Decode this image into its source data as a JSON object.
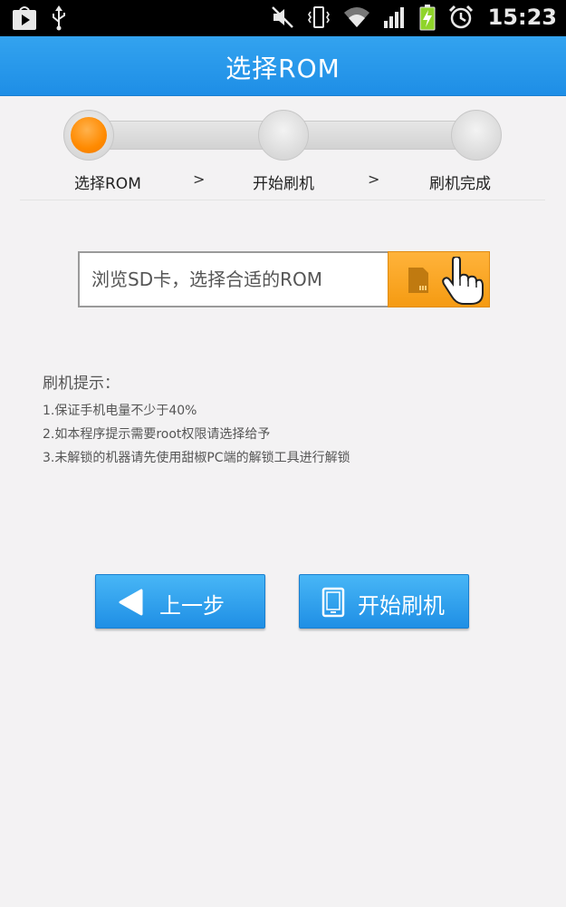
{
  "status_bar": {
    "time": "15:23",
    "icons": [
      "play-store-icon",
      "usb-icon",
      "mute-icon",
      "vibrate-icon",
      "wifi-icon",
      "signal-icon",
      "battery-charging-icon",
      "alarm-icon"
    ]
  },
  "header": {
    "title": "选择ROM"
  },
  "stepper": {
    "steps": [
      {
        "label": "选择ROM",
        "active": true
      },
      {
        "label": "开始刷机",
        "active": false
      },
      {
        "label": "刷机完成",
        "active": false
      }
    ],
    "separator": ">"
  },
  "browse": {
    "placeholder": "浏览SD卡，选择合适的ROM",
    "button_icons": [
      "sd-card-icon",
      "hand-pointer-icon"
    ]
  },
  "tips": {
    "title": "刷机提示：",
    "items": [
      "1.保证手机电量不少于40%",
      "2.如本程序提示需要root权限请选择给予",
      "3.未解锁的机器请先使用甜椒PC端的解锁工具进行解锁"
    ]
  },
  "buttons": {
    "prev_label": "上一步",
    "start_label": "开始刷机"
  },
  "colors": {
    "header_blue": "#1e8ee6",
    "accent_orange": "#ff8a00",
    "button_blue": "#2a9cec",
    "background": "#f3f2f3"
  }
}
